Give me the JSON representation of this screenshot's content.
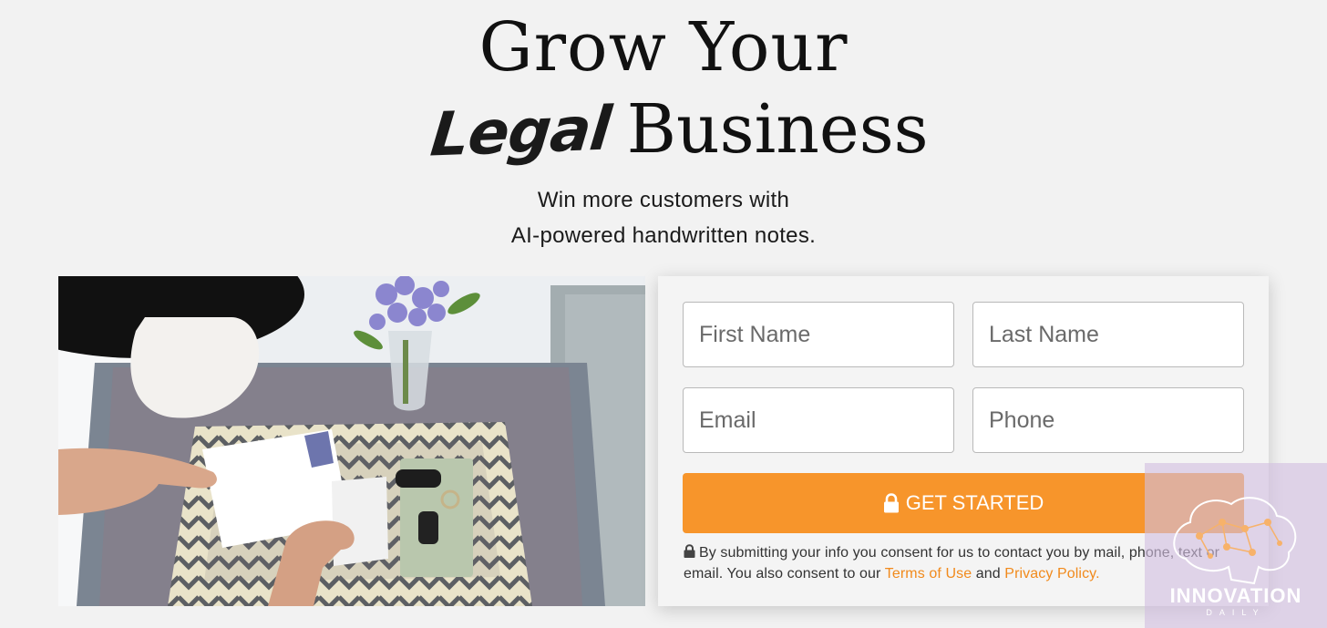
{
  "hero": {
    "title_line1": "Grow Your",
    "title_script_word": "Legal",
    "title_line2_rest": "Business",
    "subtitle_line1": "Win more customers with",
    "subtitle_line2": "AI-powered handwritten notes."
  },
  "form": {
    "first_name_placeholder": "First Name",
    "last_name_placeholder": "Last Name",
    "email_placeholder": "Email",
    "phone_placeholder": "Phone",
    "submit_label": "GET STARTED",
    "consent_text": "By submitting your info you consent for us to contact you by mail, phone, text or email. You also consent to our",
    "terms_link": "Terms of Use",
    "and_text": "and",
    "privacy_link": "Privacy Policy."
  },
  "watermark": {
    "title": "INNOVATION",
    "subtitle": "DAILY"
  },
  "colors": {
    "accent": "#f7952b",
    "link": "#f18a1c",
    "background": "#f2f2f2"
  },
  "icons": [
    "lock-icon",
    "brain-network-icon"
  ]
}
